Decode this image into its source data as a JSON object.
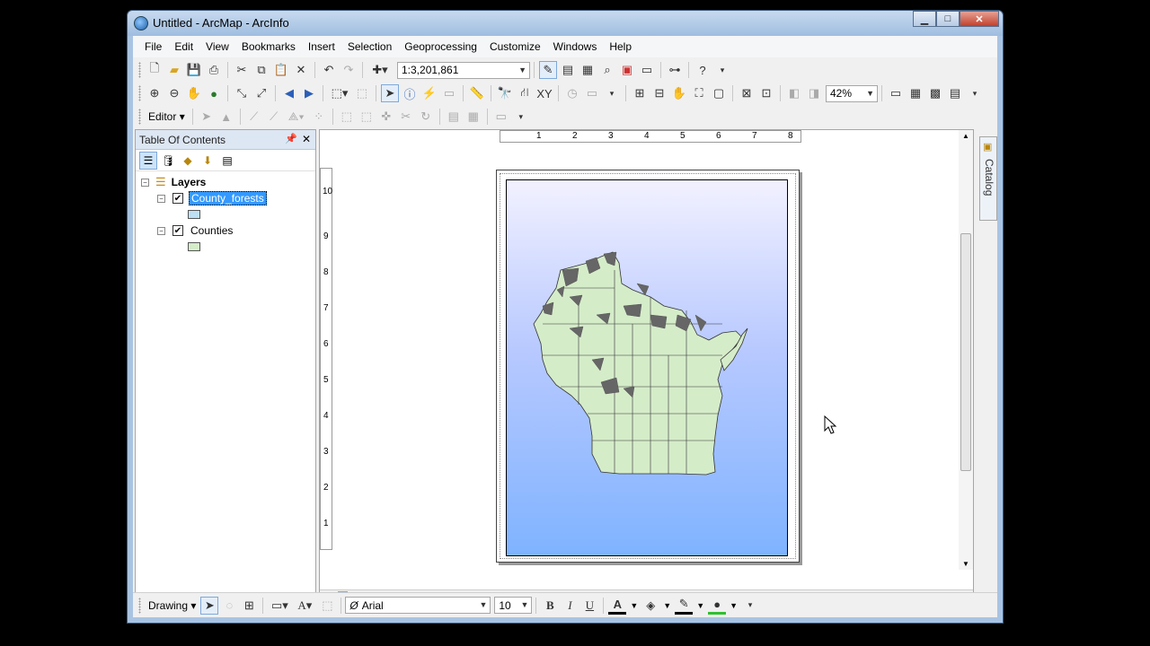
{
  "window": {
    "title": "Untitled - ArcMap - ArcInfo"
  },
  "menu": [
    "File",
    "Edit",
    "View",
    "Bookmarks",
    "Insert",
    "Selection",
    "Geoprocessing",
    "Customize",
    "Windows",
    "Help"
  ],
  "standard_toolbar": {
    "scale": "1:3,201,861"
  },
  "tools_toolbar": {
    "zoom_level": "42%"
  },
  "editor_toolbar": {
    "editor_label": "Editor"
  },
  "toc": {
    "title": "Table Of Contents",
    "root": "Layers",
    "layers": [
      {
        "name": "County_forests",
        "checked": true,
        "selected": true,
        "swatch_color": "#bde0f5"
      },
      {
        "name": "Counties",
        "checked": true,
        "selected": false,
        "swatch_color": "#d5ecc9"
      }
    ]
  },
  "ruler": {
    "horizontal_ticks": [
      "1",
      "2",
      "3",
      "4",
      "5",
      "6",
      "7",
      "8"
    ],
    "vertical_ticks": [
      "10",
      "9",
      "8",
      "7",
      "6",
      "5",
      "4",
      "3",
      "2",
      "1"
    ]
  },
  "catalog_tab": {
    "label": "Catalog"
  },
  "drawing_toolbar": {
    "drawing_label": "Drawing",
    "font": "Arial",
    "size": "10",
    "bold": "B",
    "italic": "I",
    "underline": "U",
    "font_color_letter": "A"
  },
  "colors": {
    "title_bar": "#b3cde8",
    "selection": "#3399ff",
    "county_fill": "#d5ecc9",
    "forest_fill": "#666666",
    "map_bg_top": "#f2f1ff",
    "map_bg_bottom": "#7fb3ff"
  }
}
